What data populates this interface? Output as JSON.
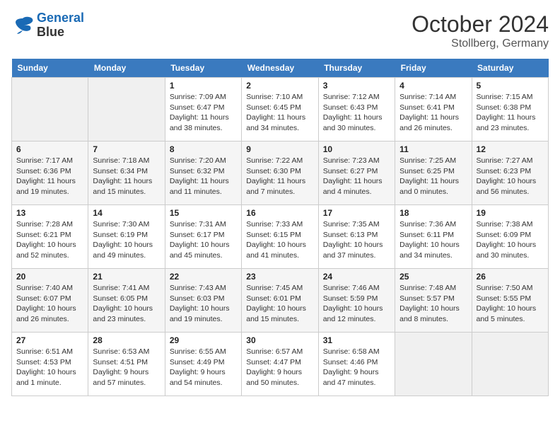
{
  "header": {
    "logo_line1": "General",
    "logo_line2": "Blue",
    "month": "October 2024",
    "location": "Stollberg, Germany"
  },
  "days_of_week": [
    "Sunday",
    "Monday",
    "Tuesday",
    "Wednesday",
    "Thursday",
    "Friday",
    "Saturday"
  ],
  "weeks": [
    [
      {
        "day": "",
        "info": ""
      },
      {
        "day": "",
        "info": ""
      },
      {
        "day": "1",
        "info": "Sunrise: 7:09 AM\nSunset: 6:47 PM\nDaylight: 11 hours and 38 minutes."
      },
      {
        "day": "2",
        "info": "Sunrise: 7:10 AM\nSunset: 6:45 PM\nDaylight: 11 hours and 34 minutes."
      },
      {
        "day": "3",
        "info": "Sunrise: 7:12 AM\nSunset: 6:43 PM\nDaylight: 11 hours and 30 minutes."
      },
      {
        "day": "4",
        "info": "Sunrise: 7:14 AM\nSunset: 6:41 PM\nDaylight: 11 hours and 26 minutes."
      },
      {
        "day": "5",
        "info": "Sunrise: 7:15 AM\nSunset: 6:38 PM\nDaylight: 11 hours and 23 minutes."
      }
    ],
    [
      {
        "day": "6",
        "info": "Sunrise: 7:17 AM\nSunset: 6:36 PM\nDaylight: 11 hours and 19 minutes."
      },
      {
        "day": "7",
        "info": "Sunrise: 7:18 AM\nSunset: 6:34 PM\nDaylight: 11 hours and 15 minutes."
      },
      {
        "day": "8",
        "info": "Sunrise: 7:20 AM\nSunset: 6:32 PM\nDaylight: 11 hours and 11 minutes."
      },
      {
        "day": "9",
        "info": "Sunrise: 7:22 AM\nSunset: 6:30 PM\nDaylight: 11 hours and 7 minutes."
      },
      {
        "day": "10",
        "info": "Sunrise: 7:23 AM\nSunset: 6:27 PM\nDaylight: 11 hours and 4 minutes."
      },
      {
        "day": "11",
        "info": "Sunrise: 7:25 AM\nSunset: 6:25 PM\nDaylight: 11 hours and 0 minutes."
      },
      {
        "day": "12",
        "info": "Sunrise: 7:27 AM\nSunset: 6:23 PM\nDaylight: 10 hours and 56 minutes."
      }
    ],
    [
      {
        "day": "13",
        "info": "Sunrise: 7:28 AM\nSunset: 6:21 PM\nDaylight: 10 hours and 52 minutes."
      },
      {
        "day": "14",
        "info": "Sunrise: 7:30 AM\nSunset: 6:19 PM\nDaylight: 10 hours and 49 minutes."
      },
      {
        "day": "15",
        "info": "Sunrise: 7:31 AM\nSunset: 6:17 PM\nDaylight: 10 hours and 45 minutes."
      },
      {
        "day": "16",
        "info": "Sunrise: 7:33 AM\nSunset: 6:15 PM\nDaylight: 10 hours and 41 minutes."
      },
      {
        "day": "17",
        "info": "Sunrise: 7:35 AM\nSunset: 6:13 PM\nDaylight: 10 hours and 37 minutes."
      },
      {
        "day": "18",
        "info": "Sunrise: 7:36 AM\nSunset: 6:11 PM\nDaylight: 10 hours and 34 minutes."
      },
      {
        "day": "19",
        "info": "Sunrise: 7:38 AM\nSunset: 6:09 PM\nDaylight: 10 hours and 30 minutes."
      }
    ],
    [
      {
        "day": "20",
        "info": "Sunrise: 7:40 AM\nSunset: 6:07 PM\nDaylight: 10 hours and 26 minutes."
      },
      {
        "day": "21",
        "info": "Sunrise: 7:41 AM\nSunset: 6:05 PM\nDaylight: 10 hours and 23 minutes."
      },
      {
        "day": "22",
        "info": "Sunrise: 7:43 AM\nSunset: 6:03 PM\nDaylight: 10 hours and 19 minutes."
      },
      {
        "day": "23",
        "info": "Sunrise: 7:45 AM\nSunset: 6:01 PM\nDaylight: 10 hours and 15 minutes."
      },
      {
        "day": "24",
        "info": "Sunrise: 7:46 AM\nSunset: 5:59 PM\nDaylight: 10 hours and 12 minutes."
      },
      {
        "day": "25",
        "info": "Sunrise: 7:48 AM\nSunset: 5:57 PM\nDaylight: 10 hours and 8 minutes."
      },
      {
        "day": "26",
        "info": "Sunrise: 7:50 AM\nSunset: 5:55 PM\nDaylight: 10 hours and 5 minutes."
      }
    ],
    [
      {
        "day": "27",
        "info": "Sunrise: 6:51 AM\nSunset: 4:53 PM\nDaylight: 10 hours and 1 minute."
      },
      {
        "day": "28",
        "info": "Sunrise: 6:53 AM\nSunset: 4:51 PM\nDaylight: 9 hours and 57 minutes."
      },
      {
        "day": "29",
        "info": "Sunrise: 6:55 AM\nSunset: 4:49 PM\nDaylight: 9 hours and 54 minutes."
      },
      {
        "day": "30",
        "info": "Sunrise: 6:57 AM\nSunset: 4:47 PM\nDaylight: 9 hours and 50 minutes."
      },
      {
        "day": "31",
        "info": "Sunrise: 6:58 AM\nSunset: 4:46 PM\nDaylight: 9 hours and 47 minutes."
      },
      {
        "day": "",
        "info": ""
      },
      {
        "day": "",
        "info": ""
      }
    ]
  ]
}
